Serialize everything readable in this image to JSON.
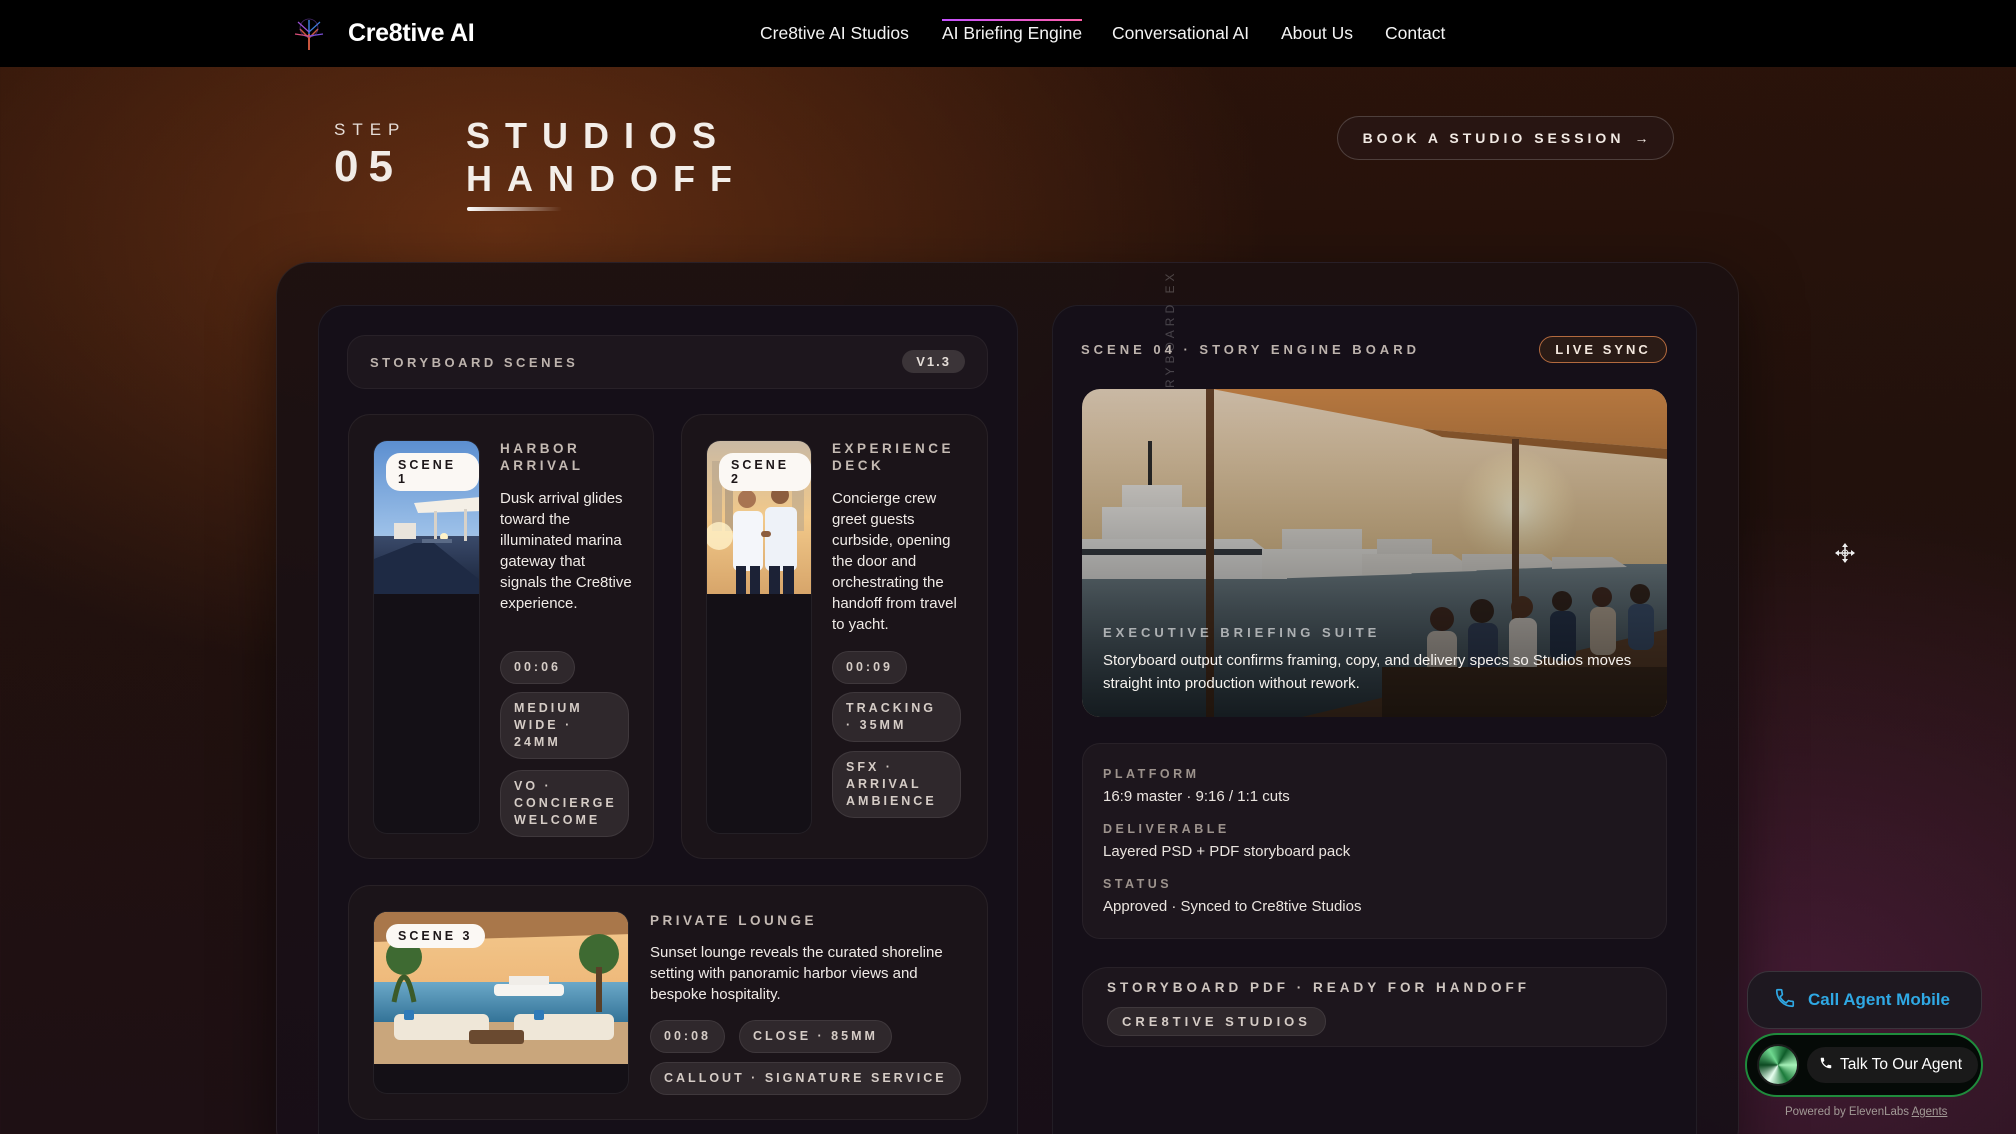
{
  "nav": {
    "brand": "Cre8tive AI",
    "links": [
      "Cre8tive AI Studios",
      "AI Briefing Engine",
      "Conversational AI",
      "About Us",
      "Contact"
    ],
    "active_index": 1
  },
  "heading": {
    "step_label": "STEP",
    "step_number": "05",
    "title_line1": "STUDIOS",
    "title_line2": "HANDOFF",
    "cta": "BOOK A STUDIO SESSION",
    "cta_arrow": "→"
  },
  "vertical_label": "RYBOARD EX",
  "storyboard": {
    "header": "STORYBOARD SCENES",
    "version": "V1.3",
    "scenes": [
      {
        "badge": "SCENE 1",
        "title": "HARBOR ARRIVAL",
        "description": "Dusk arrival glides toward the illuminated marina gateway that signals the Cre8tive experience.",
        "duration": "00:06",
        "shot": "MEDIUM WIDE · 24MM",
        "audio": "VO · CONCIERGE WELCOME"
      },
      {
        "badge": "SCENE 2",
        "title": "EXPERIENCE DECK",
        "description": "Concierge crew greet guests curbside, opening the door and orchestrating the handoff from travel to yacht.",
        "duration": "00:09",
        "shot": "TRACKING · 35MM",
        "audio": "SFX · ARRIVAL AMBIENCE"
      },
      {
        "badge": "SCENE 3",
        "title": "PRIVATE LOUNGE",
        "description": "Sunset lounge reveals the curated shoreline setting with panoramic harbor views and bespoke hospitality.",
        "duration": "00:08",
        "shot": "CLOSE · 85MM",
        "audio": "CALLOUT · SIGNATURE SERVICE"
      }
    ]
  },
  "board": {
    "title": "SCENE 04 · STORY ENGINE BOARD",
    "badge": "LIVE SYNC",
    "hero_kicker": "EXECUTIVE BRIEFING SUITE",
    "hero_caption": "Storyboard output confirms framing, copy, and delivery specs so Studios moves straight into production without rework.",
    "meta": {
      "platform_label": "PLATFORM",
      "platform_value": "16:9 master · 9:16 / 1:1 cuts",
      "deliverable_label": "DELIVERABLE",
      "deliverable_value": "Layered PSD + PDF storyboard pack",
      "status_label": "STATUS",
      "status_value": "Approved · Synced to Cre8tive Studios"
    },
    "pdf_title": "STORYBOARD PDF · READY FOR HANDOFF",
    "pdf_chip": "CRE8TIVE STUDIOS"
  },
  "widgets": {
    "call_label": "Call Agent Mobile",
    "talk_label": "Talk To Our Agent",
    "powered_prefix": "Powered by ElevenLabs ",
    "powered_link": "Agents"
  },
  "colors": {
    "accent_link": "#2fa8e4",
    "agent_border": "#1f8b3c",
    "live_badge_border": "#b36a3e"
  }
}
